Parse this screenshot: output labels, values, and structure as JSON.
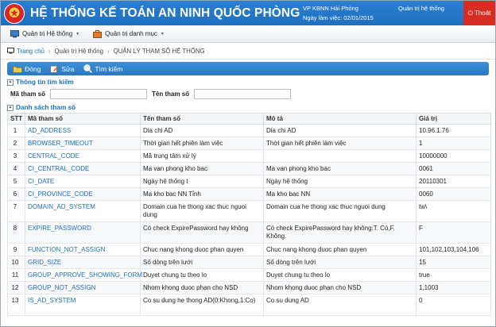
{
  "header": {
    "logo_text": "★",
    "title": "HỆ THỐNG KẾ TOÁN AN NINH QUỐC PHÒNG",
    "org": "VP KBNN Hải Phòng",
    "workday": "Ngày làm việc: 02/01/2015",
    "user": "Quản trị hệ thống",
    "logout": "Thoát"
  },
  "menu": {
    "items": [
      {
        "label": "Quản trị Hệ thống",
        "icon": "monitor-icon"
      },
      {
        "label": "Quản trị danh mục",
        "icon": "briefcase-icon"
      }
    ]
  },
  "breadcrumb": {
    "home": "Trang chủ",
    "level1": "Quản trị Hệ thống",
    "current": "QUẢN LÝ THAM SỐ HỆ THỐNG"
  },
  "toolbar": {
    "close": "Đóng",
    "edit": "Sửa",
    "search": "Tìm kiếm"
  },
  "search": {
    "section_title": "Thông tin tìm kiếm",
    "code_label": "Mã tham số",
    "code_value": "",
    "name_label": "Tên tham số",
    "name_value": ""
  },
  "list": {
    "section_title": "Danh sách tham số",
    "columns": [
      "STT",
      "Mã tham số",
      "Tên tham số",
      "Mô tả",
      "Giá trị"
    ],
    "rows": [
      [
        "1",
        "AD_ADDRESS",
        "Dia chi AD",
        "Dia chi AD",
        "10.96.1.76"
      ],
      [
        "2",
        "BROWSER_TIMEOUT",
        "Thời gian hết phiên làm việc",
        "Thời gian hết phiên làm việc",
        "1"
      ],
      [
        "3",
        "CENTRAL_CODE",
        "Mã trung tâm xử lý",
        "",
        "10000000"
      ],
      [
        "4",
        "CI_CENTRAL_CODE",
        "Ma van phong kho bac",
        "Ma van phong kho bac",
        "0061"
      ],
      [
        "5",
        "CI_DATE",
        "Ngày hệ thống t",
        "Ngày hệ thống",
        "20110301"
      ],
      [
        "6",
        "CI_PROVINCE_CODE",
        "Ma kho bac NN Tỉnh",
        "Ma kho bac NN",
        "0060"
      ],
      [
        "7",
        "DOMAIN_AD_SYSTEM",
        "Domain cua he thong xac thuc nguoi dung",
        "Domain cua he thong xac thuc nguoi dung",
        "tw\\"
      ],
      [
        "8",
        "EXPIRE_PASSWORD",
        "Có check ExpirePassword hay không",
        "Có check ExpirePassword hay không:T. Có,F. Không.",
        "F"
      ],
      [
        "9",
        "FUNCTION_NOT_ASSIGN",
        "Chuc nang khong duoc phan quyen",
        "Chuc nang khong duoc phan quyen",
        "101,102,103,104,106"
      ],
      [
        "10",
        "GRID_SIZE",
        "Số dòng trên lưới",
        "Số dòng trên lưới",
        "15"
      ],
      [
        "11",
        "GROUP_APPROVE_SHOWING_FORM",
        "Duyet chung tu theo lo",
        "Duyet chung tu theo lo",
        "true"
      ],
      [
        "12",
        "GROUP_NOT_ASSIGN",
        "Nhom khong duoc phan cho NSD",
        "Nhom khong duoc phan cho NSD",
        "1,1003"
      ],
      [
        "13",
        "IS_AD_SYSTEM",
        "Co su dung he thong AD(0:Khong,1:Co)",
        "Co su dung AD",
        "0"
      ]
    ]
  },
  "colors": {
    "header_blue": "#1f6fbf",
    "logout_red": "#d62c22",
    "link_blue": "#1d6fc4"
  }
}
